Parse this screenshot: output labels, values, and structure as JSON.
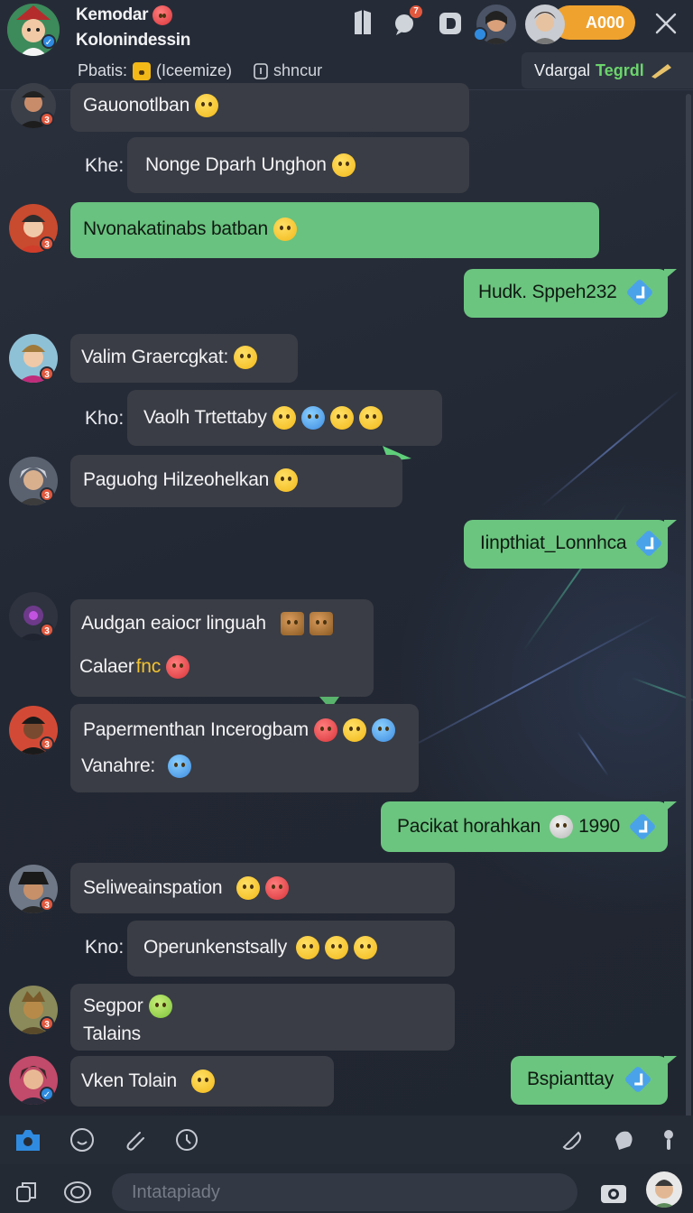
{
  "header": {
    "title": "Kemodar",
    "subtitle": "Kolonindessin",
    "status_label": "Pbatis:",
    "status_value": "(Iceemize)",
    "sync_label": "shncur",
    "coin_label": "A000",
    "pinned_text": "Vdargal",
    "pinned_highlight": "Tegrdl",
    "notif_count": "7"
  },
  "messages": [
    {
      "type": "in",
      "lines": [
        "Gauonotlban"
      ],
      "emoji": [
        "yellow"
      ]
    },
    {
      "type": "reply",
      "prefix": "Khe:",
      "text": "Nonge Dparh Unghon",
      "emoji": [
        "yellow"
      ]
    },
    {
      "type": "in-green",
      "text": "Nvonakatinabs batban",
      "emoji": [
        "yellow"
      ]
    },
    {
      "type": "out",
      "text": "Hudk. Sppeh232"
    },
    {
      "type": "in",
      "text": "Valim Graercgkat:",
      "emoji": [
        "yellow"
      ]
    },
    {
      "type": "reply",
      "prefix": "Kho:",
      "text": "Vaolh Trtettaby",
      "emoji": [
        "yellow",
        "blue",
        "yellow",
        "yellow"
      ]
    },
    {
      "type": "in",
      "text": "Paguohg Hilzeohelkan",
      "emoji": [
        "yellow"
      ]
    },
    {
      "type": "out",
      "text": "Iinpthiat_Lonnhca"
    },
    {
      "type": "in",
      "line1": "Audgan eaiocr linguah",
      "line2_a": "Calaer",
      "line2_b": "fnc"
    },
    {
      "type": "in",
      "line1": "Papermenthan Incerogbam",
      "line2": "Vanahre:"
    },
    {
      "type": "out",
      "text": "Pacikat horahkan",
      "value": "1990"
    },
    {
      "type": "in",
      "text": "Seliweainspation"
    },
    {
      "type": "reply",
      "prefix": "Kno:",
      "text": "Operunkenstsally"
    },
    {
      "type": "in",
      "line1": "Segpor",
      "line2": "Talains"
    },
    {
      "type": "in",
      "text": "Vken Tolain"
    },
    {
      "type": "out",
      "text": "Bspianttay"
    }
  ],
  "input": {
    "placeholder": "Intatapiady"
  },
  "colors": {
    "accent_green": "#6bc57f",
    "coin_orange": "#f0a22e",
    "bubble_dark": "#3a3d45",
    "check_blue": "#4aa3e8"
  },
  "icons": [
    "shield-icon",
    "chat-icon",
    "stop-icon",
    "close-icon",
    "camera-icon",
    "smile-icon",
    "pin-icon",
    "clock-icon",
    "attach-icon",
    "sticker-icon",
    "more-icon",
    "copy-icon",
    "mention-icon",
    "photo-icon"
  ]
}
